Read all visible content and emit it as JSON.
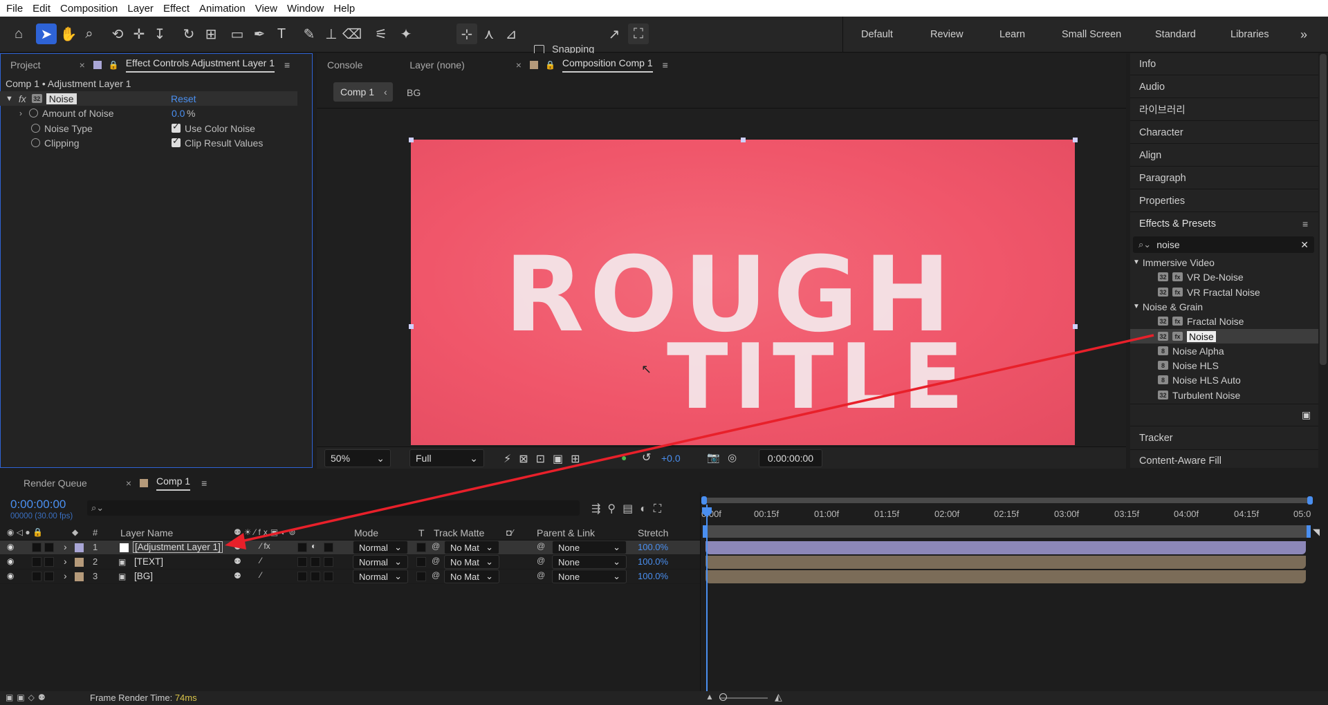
{
  "menu": [
    "File",
    "Edit",
    "Composition",
    "Layer",
    "Effect",
    "Animation",
    "View",
    "Window",
    "Help"
  ],
  "toolbar": {
    "snapping_label": "Snapping",
    "workspaces": [
      "Default",
      "Review",
      "Learn",
      "Small Screen",
      "Standard",
      "Libraries"
    ],
    "more_symbol": "»"
  },
  "left_panel": {
    "tab_project": "Project",
    "tab_effect_controls": "Effect Controls Adjustment Layer 1",
    "breadcrumb": "Comp 1 • Adjustment Layer 1",
    "effect_name": "Noise",
    "reset_label": "Reset",
    "fx_label": "fx",
    "props": [
      {
        "label": "Amount of Noise",
        "value": "0.0",
        "unit": "%"
      },
      {
        "label": "Noise Type",
        "value": "Use Color Noise"
      },
      {
        "label": "Clipping",
        "value": "Clip Result Values"
      }
    ]
  },
  "viewer": {
    "tab_console": "Console",
    "tab_layer": "Layer (none)",
    "tab_comp": "Composition Comp 1",
    "crumb_active": "Comp 1",
    "crumb_next": "BG",
    "title_line1": "ROUGH",
    "title_line2": "TITLE",
    "zoom": "50%",
    "resolution": "Full",
    "exposure": "+0.0",
    "timecode": "0:00:00:00",
    "canvas_color": "#f0566a"
  },
  "right_panel": {
    "items_top": [
      "Info",
      "Audio",
      "라이브러리",
      "Character",
      "Align",
      "Paragraph",
      "Properties"
    ],
    "effects_title": "Effects & Presets",
    "search_value": "noise",
    "groups": [
      {
        "name": "Immersive Video",
        "items": [
          "VR De-Noise",
          "VR Fractal Noise"
        ]
      },
      {
        "name": "Noise & Grain",
        "items": [
          "Fractal Noise",
          "Noise",
          "Noise Alpha",
          "Noise HLS",
          "Noise HLS Auto",
          "Turbulent Noise"
        ]
      }
    ],
    "selected_item": "Noise",
    "items_bottom": [
      "Tracker",
      "Content-Aware Fill"
    ]
  },
  "timeline": {
    "tab_render_queue": "Render Queue",
    "tab_comp": "Comp 1",
    "timecode": "0:00:00:00",
    "fps_line": "00000 (30.00 fps)",
    "col_hash": "#",
    "col_layer_name": "Layer Name",
    "col_mode": "Mode",
    "col_t": "T",
    "col_track_matte": "Track Matte",
    "col_parent": "Parent & Link",
    "col_stretch": "Stretch",
    "ruler": [
      "0:00f",
      "00:15f",
      "01:00f",
      "01:15f",
      "02:00f",
      "02:15f",
      "03:00f",
      "03:15f",
      "04:00f",
      "04:15f",
      "05:0"
    ],
    "layers": [
      {
        "num": "1",
        "name": "[Adjustment Layer 1]",
        "mode": "Normal",
        "matte": "No Mat",
        "parent": "None",
        "stretch": "100.0%",
        "label_color": "#a9a6d6",
        "bar_color": "#8c87b8"
      },
      {
        "num": "2",
        "name": "[TEXT]",
        "mode": "Normal",
        "matte": "No Mat",
        "parent": "None",
        "stretch": "100.0%",
        "label_color": "#b59a7a",
        "bar_color": "#7b6c58"
      },
      {
        "num": "3",
        "name": "[BG]",
        "mode": "Normal",
        "matte": "No Mat",
        "parent": "None",
        "stretch": "100.0%",
        "label_color": "#b59a7a",
        "bar_color": "#7b6c58"
      }
    ],
    "frame_render_label": "Frame Render Time:",
    "frame_render_value": "74ms"
  }
}
